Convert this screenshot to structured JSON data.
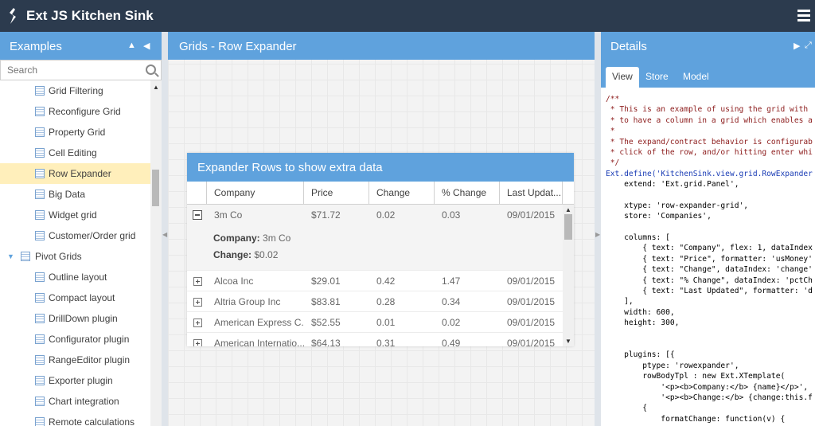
{
  "app": {
    "title": "Ext JS Kitchen Sink"
  },
  "left": {
    "title": "Examples",
    "search_placeholder": "Search",
    "items": [
      {
        "label": "Grid Filtering",
        "type": "child"
      },
      {
        "label": "Reconfigure Grid",
        "type": "child"
      },
      {
        "label": "Property Grid",
        "type": "child"
      },
      {
        "label": "Cell Editing",
        "type": "child"
      },
      {
        "label": "Row Expander",
        "type": "child",
        "selected": true
      },
      {
        "label": "Big Data",
        "type": "child"
      },
      {
        "label": "Widget grid",
        "type": "child"
      },
      {
        "label": "Customer/Order grid",
        "type": "child"
      },
      {
        "label": "Pivot Grids",
        "type": "parent"
      },
      {
        "label": "Outline layout",
        "type": "child"
      },
      {
        "label": "Compact layout",
        "type": "child"
      },
      {
        "label": "DrillDown plugin",
        "type": "child"
      },
      {
        "label": "Configurator plugin",
        "type": "child"
      },
      {
        "label": "RangeEditor plugin",
        "type": "child"
      },
      {
        "label": "Exporter plugin",
        "type": "child"
      },
      {
        "label": "Chart integration",
        "type": "child"
      },
      {
        "label": "Remote calculations",
        "type": "child"
      }
    ]
  },
  "center": {
    "title": "Grids - Row Expander",
    "grid": {
      "title": "Expander Rows to show extra data",
      "columns": [
        "Company",
        "Price",
        "Change",
        "% Change",
        "Last Updat..."
      ],
      "rows": [
        {
          "company": "3m Co",
          "price": "$71.72",
          "change": "0.02",
          "pct": "0.03",
          "updated": "09/01/2015",
          "expanded": true
        },
        {
          "company": "Alcoa Inc",
          "price": "$29.01",
          "change": "0.42",
          "pct": "1.47",
          "updated": "09/01/2015"
        },
        {
          "company": "Altria Group Inc",
          "price": "$83.81",
          "change": "0.28",
          "pct": "0.34",
          "updated": "09/01/2015"
        },
        {
          "company": "American Express C...",
          "price": "$52.55",
          "change": "0.01",
          "pct": "0.02",
          "updated": "09/01/2015"
        },
        {
          "company": "American Internatio...",
          "price": "$64.13",
          "change": "0.31",
          "pct": "0.49",
          "updated": "09/01/2015"
        }
      ],
      "expanded_body": {
        "company_label": "Company:",
        "company_value": "3m Co",
        "change_label": "Change:",
        "change_value": "$0.02"
      }
    }
  },
  "right": {
    "title": "Details",
    "tabs": [
      "View",
      "Store",
      "Model"
    ],
    "code_lines": [
      {
        "t": "/**",
        "cls": "c"
      },
      {
        "t": " * This is an example of using the grid with",
        "cls": "c"
      },
      {
        "t": " * to have a column in a grid which enables a",
        "cls": "c"
      },
      {
        "t": " *",
        "cls": "c"
      },
      {
        "t": " * The expand/contract behavior is configurab",
        "cls": "c"
      },
      {
        "t": " * click of the row, and/or hitting enter whi",
        "cls": "c"
      },
      {
        "t": " */",
        "cls": "c"
      },
      {
        "t": "Ext.define('KitchenSink.view.grid.RowExpander",
        "cls": "k"
      },
      {
        "t": "    extend: 'Ext.grid.Panel',",
        "cls": ""
      },
      {
        "t": "",
        "cls": ""
      },
      {
        "t": "    xtype: 'row-expander-grid',",
        "cls": ""
      },
      {
        "t": "    store: 'Companies',",
        "cls": ""
      },
      {
        "t": "",
        "cls": ""
      },
      {
        "t": "    columns: [",
        "cls": ""
      },
      {
        "t": "        { text: \"Company\", flex: 1, dataIndex",
        "cls": ""
      },
      {
        "t": "        { text: \"Price\", formatter: 'usMoney'",
        "cls": ""
      },
      {
        "t": "        { text: \"Change\", dataIndex: 'change'",
        "cls": ""
      },
      {
        "t": "        { text: \"% Change\", dataIndex: 'pctCh",
        "cls": ""
      },
      {
        "t": "        { text: \"Last Updated\", formatter: 'd",
        "cls": ""
      },
      {
        "t": "    ],",
        "cls": ""
      },
      {
        "t": "    width: 600,",
        "cls": ""
      },
      {
        "t": "    height: 300,",
        "cls": ""
      },
      {
        "t": "",
        "cls": ""
      },
      {
        "t": "",
        "cls": ""
      },
      {
        "t": "    plugins: [{",
        "cls": ""
      },
      {
        "t": "        ptype: 'rowexpander',",
        "cls": ""
      },
      {
        "t": "        rowBodyTpl : new Ext.XTemplate(",
        "cls": ""
      },
      {
        "t": "            '<p><b>Company:</b> {name}</p>',",
        "cls": ""
      },
      {
        "t": "            '<p><b>Change:</b> {change:this.f",
        "cls": ""
      },
      {
        "t": "        {",
        "cls": ""
      },
      {
        "t": "            formatChange: function(v) {",
        "cls": ""
      }
    ]
  }
}
